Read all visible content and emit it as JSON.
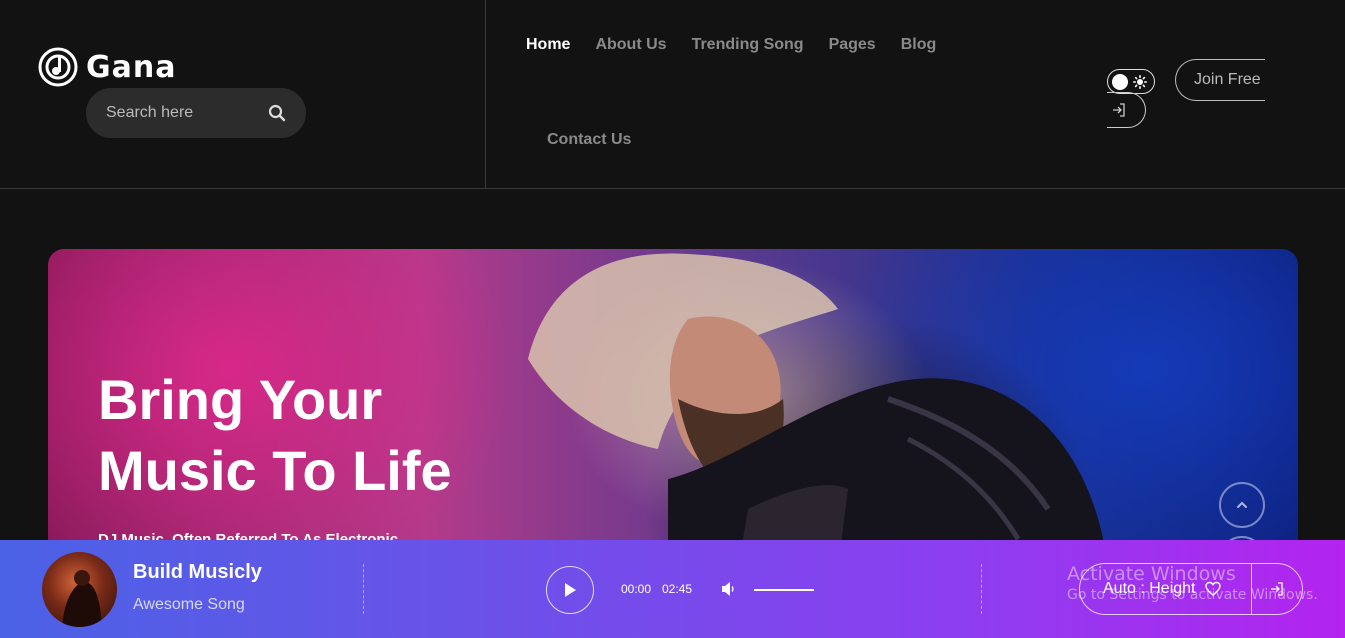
{
  "brand": {
    "name": "Gana",
    "logo_icon": "music-disc-icon"
  },
  "search": {
    "placeholder": "Search here",
    "icon": "search-icon"
  },
  "nav": {
    "items": [
      {
        "label": "Home",
        "active": true
      },
      {
        "label": "About Us",
        "active": false
      },
      {
        "label": "Trending Song",
        "active": false
      },
      {
        "label": "Pages",
        "active": false
      },
      {
        "label": "Blog",
        "active": false
      }
    ],
    "contact_label": "Contact Us"
  },
  "header_actions": {
    "theme_icon": "sun-icon",
    "login_icon": "login-icon",
    "join_label": "Join Free"
  },
  "hero": {
    "title": "Bring Your Music To Life",
    "subtitle": "DJ Music, Often Referred To As Electronic"
  },
  "player": {
    "track_title": "Build Musicly",
    "track_artist": "Awesome Song",
    "time_current": "00:00",
    "time_total": "02:45",
    "volume_icon": "volume-icon",
    "height_label": "Auto : Height",
    "height_icons": [
      "heart-icon",
      "login-icon"
    ]
  },
  "os_overlay": {
    "title": "Activate Windows",
    "subtitle": "Go to Settings to activate Windows."
  },
  "colors": {
    "background": "#121212",
    "player_start": "#4b62e6",
    "player_end": "#b324ee",
    "nav_inactive": "#8a8a8a"
  }
}
